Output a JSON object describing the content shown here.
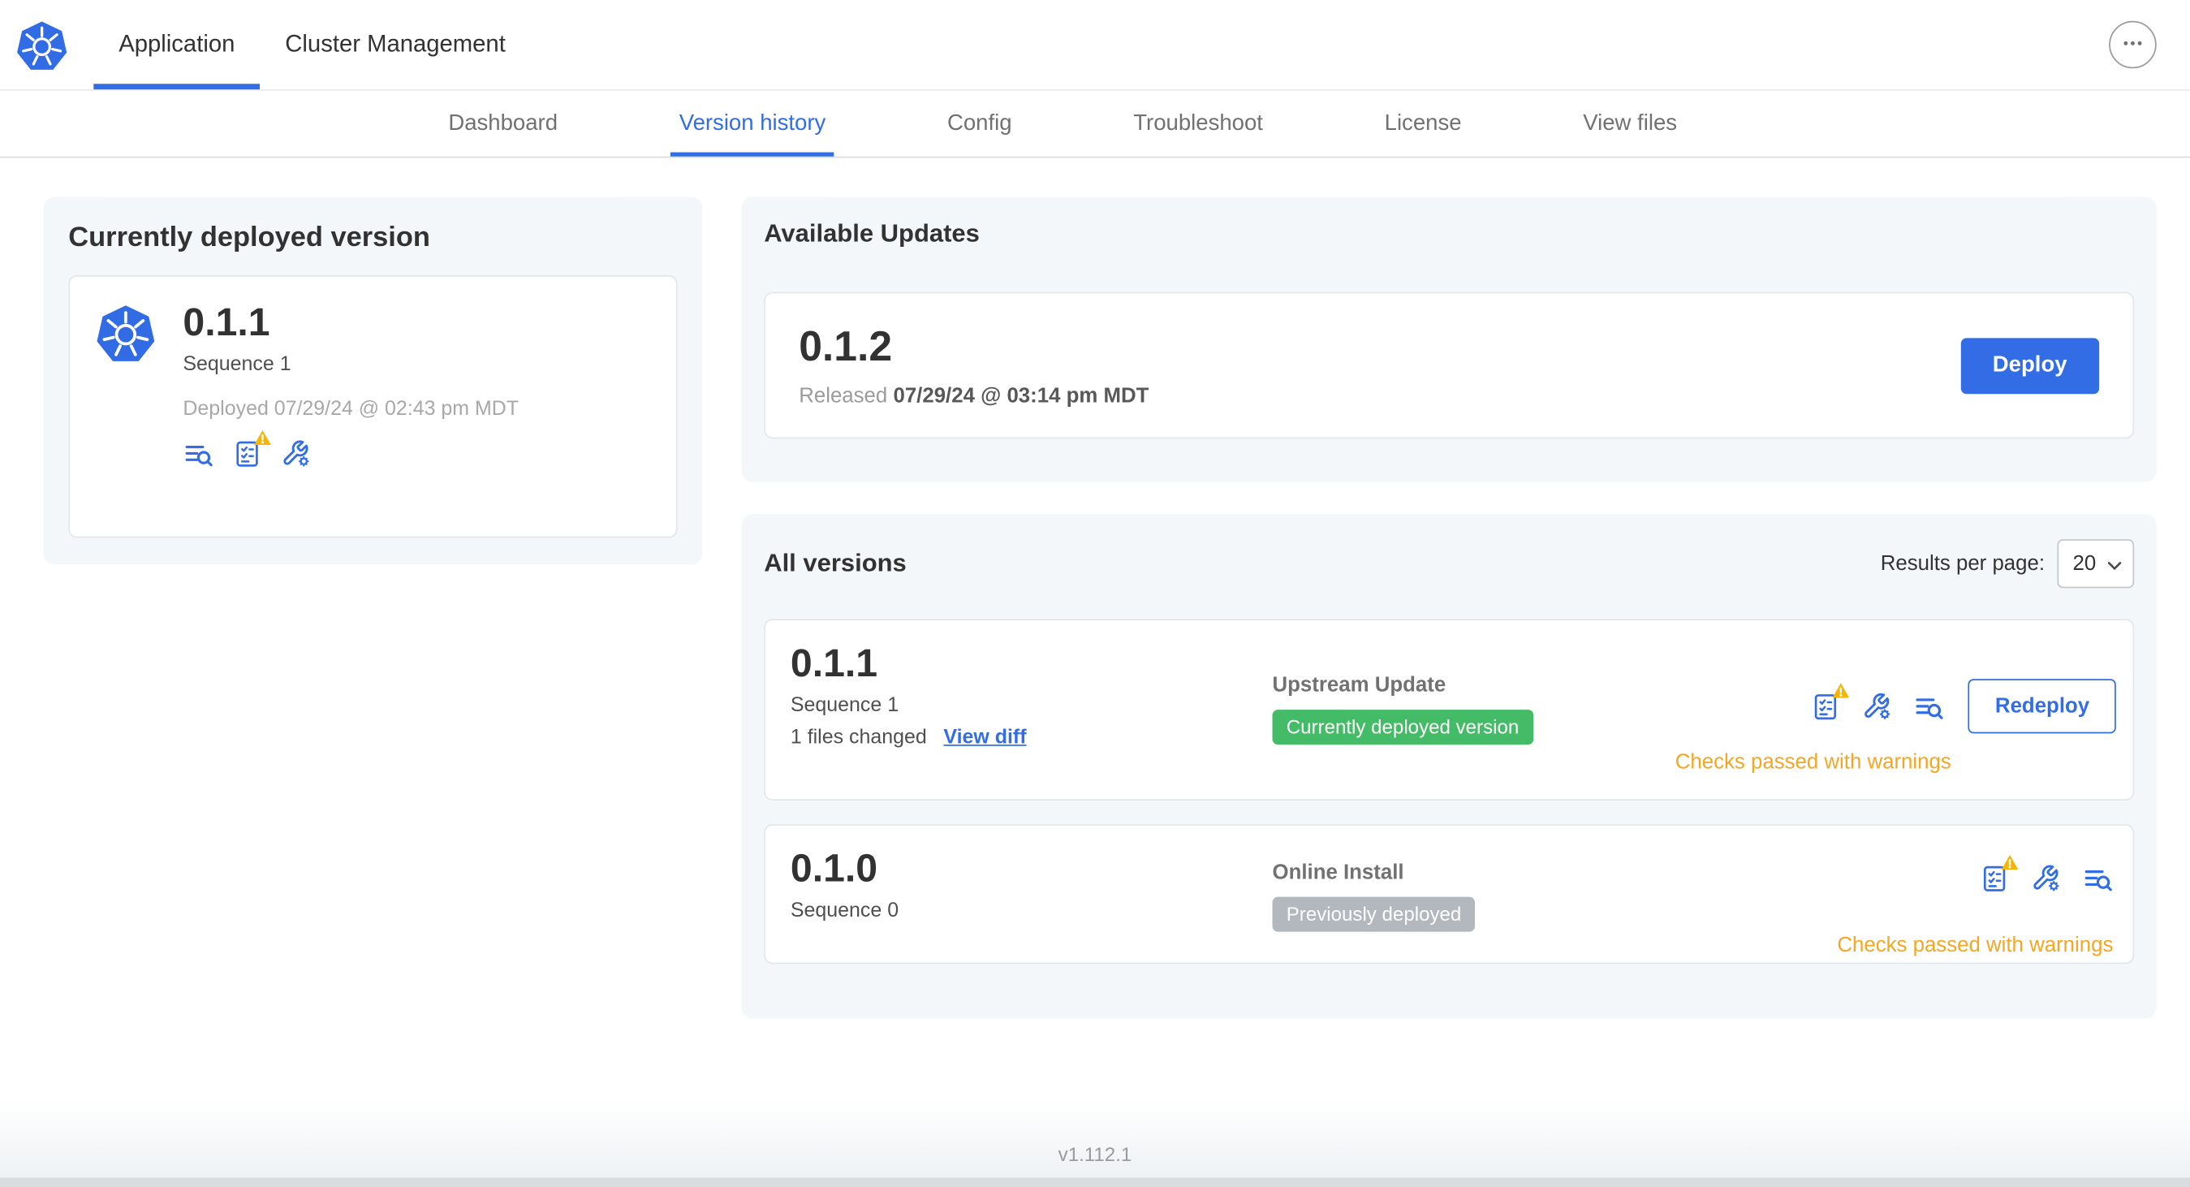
{
  "header": {
    "tabs": [
      {
        "label": "Application",
        "active": true
      },
      {
        "label": "Cluster Management",
        "active": false
      }
    ],
    "more_menu": "more-menu"
  },
  "nav": {
    "items": [
      {
        "label": "Dashboard",
        "active": false
      },
      {
        "label": "Version history",
        "active": true
      },
      {
        "label": "Config",
        "active": false
      },
      {
        "label": "Troubleshoot",
        "active": false
      },
      {
        "label": "License",
        "active": false
      },
      {
        "label": "View files",
        "active": false
      }
    ]
  },
  "current_version": {
    "title": "Currently deployed version",
    "version": "0.1.1",
    "sequence": "Sequence 1",
    "deployed_at": "Deployed 07/29/24 @ 02:43 pm MDT"
  },
  "available_updates": {
    "title": "Available Updates",
    "version": "0.1.2",
    "released_prefix": "Released",
    "released_date": "07/29/24 @ 03:14 pm MDT",
    "deploy_label": "Deploy"
  },
  "all_versions": {
    "title": "All versions",
    "results_per_page_label": "Results per page:",
    "results_per_page_value": "20",
    "rows": [
      {
        "version": "0.1.1",
        "sequence": "Sequence 1",
        "files_changed": "1 files changed",
        "view_diff_label": "View diff",
        "source": "Upstream Update",
        "badge": "Currently deployed version",
        "badge_type": "green",
        "action_label": "Redeploy",
        "status": "Checks passed with warnings"
      },
      {
        "version": "0.1.0",
        "sequence": "Sequence 0",
        "source": "Online Install",
        "badge": "Previously deployed",
        "badge_type": "gray",
        "status": "Checks passed with warnings"
      }
    ]
  },
  "footer": {
    "app_version": "v1.112.1"
  },
  "icons": {
    "logo": "kubernetes-logo",
    "logs": "deploy-logs-icon",
    "checks": "preflight-checks-icon",
    "warning": "warning-triangle-icon",
    "config": "edit-config-icon",
    "more": "more-menu-icon",
    "chevron": "chevron-down-icon"
  },
  "colors": {
    "accent": "#326de6",
    "warning_badge": "#f7b500",
    "warning_text": "#f5a623",
    "success_badge": "#44bb66",
    "neutral_badge": "#b2b8be"
  }
}
